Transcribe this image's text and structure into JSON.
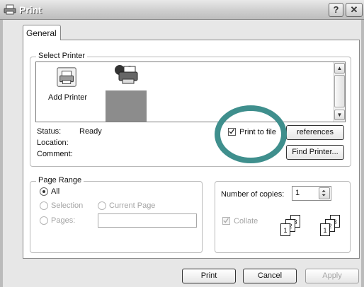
{
  "window": {
    "title": "Print",
    "help_label": "?",
    "close_label": "✕"
  },
  "tabs": {
    "general": "General"
  },
  "select_printer": {
    "group_label": "Select Printer",
    "add_printer_label": "Add Printer",
    "scroll_up_glyph": "▲",
    "scroll_down_glyph": "▼"
  },
  "printer_info": {
    "status_label": "Status:",
    "status_value": "Ready",
    "location_label": "Location:",
    "comment_label": "Comment:",
    "print_to_file_label": "Print to file",
    "print_to_file_checked": true,
    "preferences_label": "references",
    "find_printer_label": "Find Printer..."
  },
  "page_range": {
    "group_label": "Page Range",
    "options": [
      "All",
      "Selection",
      "Current Page",
      "Pages:"
    ],
    "selected": "All",
    "pages_value": ""
  },
  "copies": {
    "label": "Number of copies:",
    "value": "1",
    "collate_label": "Collate",
    "collate_checked": true,
    "sheet_numbers": [
      "1",
      "2",
      "3"
    ]
  },
  "footer": {
    "print_label": "Print",
    "cancel_label": "Cancel",
    "apply_label": "Apply"
  },
  "annotation": {
    "color": "#3f8f8d"
  }
}
